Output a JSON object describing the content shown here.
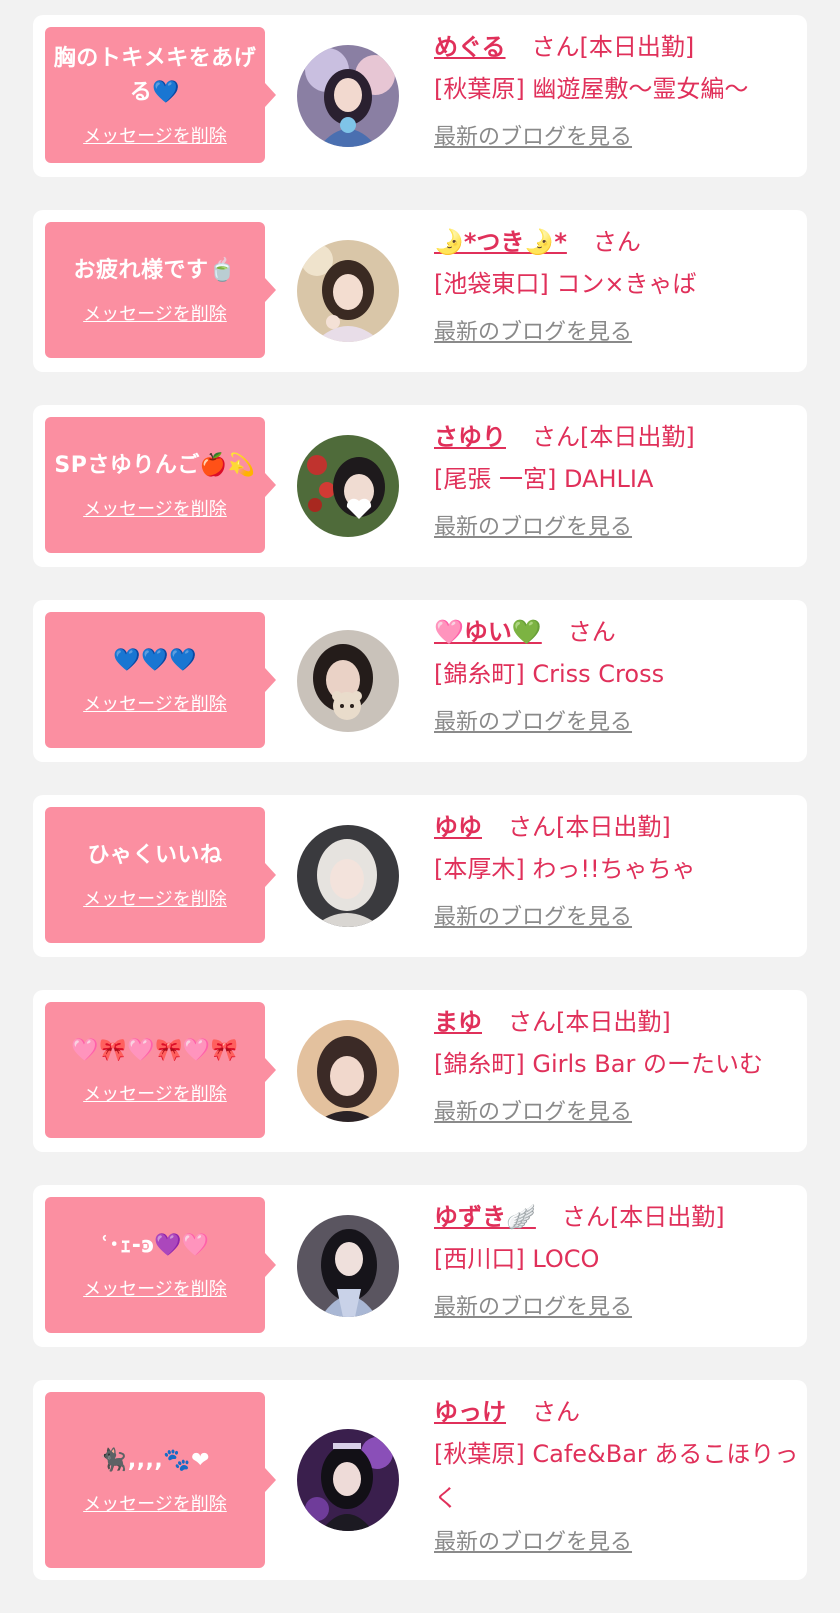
{
  "colors": {
    "background": "#f2f2f2",
    "card": "#ffffff",
    "bubble": "#fb8fa1",
    "accent": "#e0305a",
    "link_gray": "#8a8a8a"
  },
  "delete_label": "メッセージを削除",
  "blog_label": "最新のブログを見る",
  "cards": [
    {
      "message": "胸のトキメキをあげる💙",
      "name": "めぐる",
      "suffix": "さん[本日出勤]",
      "shop": "[秋葉原] 幽遊屋敷〜霊女編〜"
    },
    {
      "message": "お疲れ様です🍵",
      "name": "🌛*つき🌛*",
      "suffix": "さん",
      "shop": "[池袋東口] コン×きゃば"
    },
    {
      "message": "SPさゆりんご🍎💫",
      "name": "さゆり",
      "suffix": "さん[本日出勤]",
      "shop": "[尾張 一宮] DAHLIA"
    },
    {
      "message": "💙💙💙",
      "name": "🩷ゆい💚",
      "suffix": "さん",
      "shop": "[錦糸町] Criss Cross"
    },
    {
      "message": "ひゃくいいね",
      "name": "ゆゆ",
      "suffix": "さん[本日出勤]",
      "shop": "[本厚木] わっ!!ちゃちゃ"
    },
    {
      "message": "🩷🎀🩷🎀🩷🎀",
      "name": "まゆ",
      "suffix": "さん[本日出勤]",
      "shop": "[錦糸町] Girls Bar のーたいむ"
    },
    {
      "message": "ʿ･ｪ-ͽ💜🩷",
      "name": "ゆずき🪽",
      "suffix": "さん[本日出勤]",
      "shop": "[西川口] LOCO"
    },
    {
      "message": "🐈‍⬛,,,,🐾❤",
      "name": "ゆっけ",
      "suffix": "さん",
      "shop": "[秋葉原] Cafe&Bar あるこほりっく"
    }
  ]
}
